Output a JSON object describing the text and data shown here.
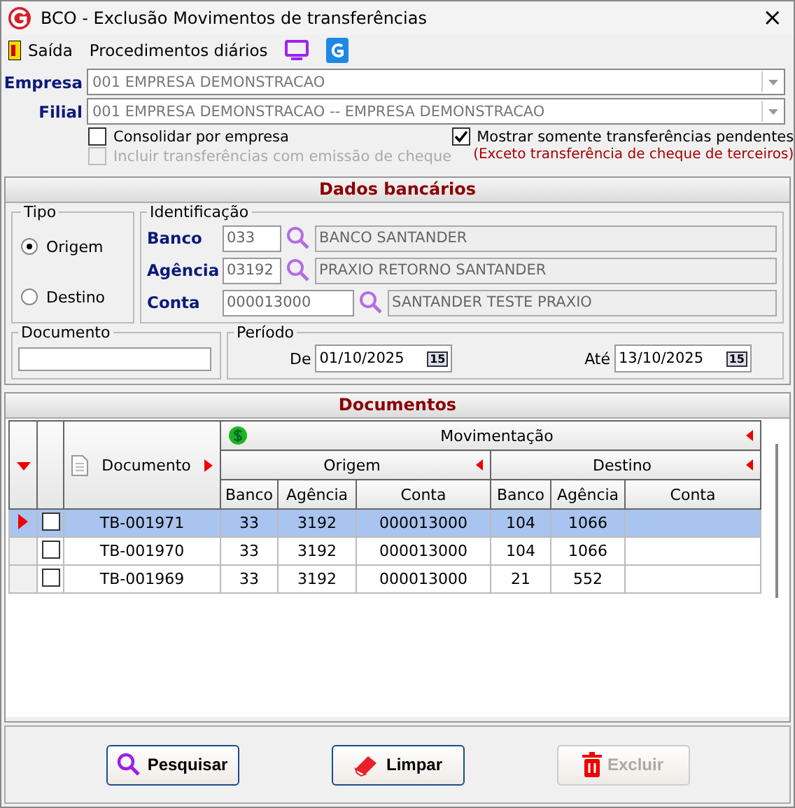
{
  "window": {
    "title": "BCO - Exclusão Movimentos de transferências",
    "close": "×"
  },
  "menu": [
    {
      "kind": "exit",
      "label": "Saída"
    },
    {
      "kind": "text",
      "label": "Procedimentos diários"
    },
    {
      "kind": "monitor"
    },
    {
      "kind": "logo"
    }
  ],
  "empresa": {
    "label": "Empresa",
    "value": "001 EMPRESA DEMONSTRACAO",
    "disabled": true
  },
  "filial": {
    "label": "Filial",
    "value": "001 EMPRESA DEMONSTRACAO -- EMPRESA DEMONSTRACAO",
    "disabled": true
  },
  "options": [
    {
      "label": "Consolidar por empresa",
      "checked": false,
      "disabled": false
    },
    {
      "label": "Incluir transferências com emissão de cheque",
      "checked": false,
      "disabled": true
    },
    {
      "label": "Mostrar somente transferências pendentes",
      "checked": true,
      "disabled": false
    }
  ],
  "note": "(Exceto transferência de cheque de terceiros)",
  "dados_bancarios": {
    "title": "Dados bancários",
    "tipo": {
      "title": "Tipo",
      "options": [
        {
          "label": "Origem",
          "selected": true
        },
        {
          "label": "Destino",
          "selected": false
        }
      ]
    },
    "identificacao": {
      "title": "Identificação",
      "fields": [
        {
          "label": "Banco",
          "code": "033",
          "name": "BANCO SANTANDER"
        },
        {
          "label": "Agência",
          "code": "03192",
          "name": "PRAXIO RETORNO SANTANDER"
        },
        {
          "label": "Conta",
          "code": "000013000",
          "name": "SANTANDER TESTE PRAXIO"
        }
      ]
    },
    "documento": {
      "title": "Documento"
    },
    "periodo": {
      "title": "Período",
      "from_label": "De",
      "from": "01/10/2025",
      "to_label": "Até",
      "to": "13/10/2025",
      "from_calendar": "15",
      "to_calendar": "15"
    }
  },
  "documentos": {
    "title": "Documentos",
    "group": "Movimentação",
    "column_doc": "Documento",
    "origem": "Origem",
    "destino": "Destino",
    "columns": [
      "Banco",
      "Agência",
      "Conta",
      "Banco",
      "Agência",
      "Conta"
    ],
    "rows": [
      {
        "documento": "TB-001971",
        "checked": false,
        "selected": true,
        "cells": [
          "33",
          "3192",
          "000013000",
          "104",
          "1066"
        ]
      },
      {
        "documento": "TB-001970",
        "checked": false,
        "selected": false,
        "cells": [
          "33",
          "3192",
          "000013000",
          "104",
          "1066"
        ]
      },
      {
        "documento": "TB-001969",
        "checked": false,
        "selected": false,
        "cells": [
          "33",
          "3192",
          "000013000",
          "21",
          "552"
        ]
      }
    ]
  },
  "buttons": [
    {
      "kind": "search",
      "label": "Pesquisar",
      "disabled": false
    },
    {
      "kind": "clear",
      "label": "Limpar",
      "disabled": false
    },
    {
      "kind": "delete",
      "label": "Excluir",
      "disabled": true
    }
  ]
}
